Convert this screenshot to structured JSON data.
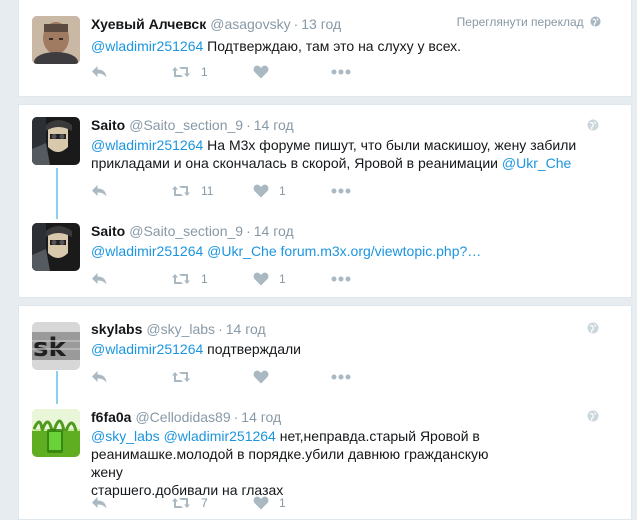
{
  "tweets": [
    {
      "name": "Хуевый Алчевск",
      "handle": "@asagovsky",
      "time": "13 год",
      "view_conversation": "Переглянути переклад",
      "text_parts": [
        "@wladimir251264",
        " Подтверждаю, там это на слуху у всех."
      ],
      "retweets": "1",
      "likes": ""
    },
    {
      "name": "Saito",
      "handle": "@Saito_section_9",
      "time": "14 год",
      "text_line1_parts": [
        "@wladimir251264",
        " На M3x форуме пишут, что были маскишоу, жену забили"
      ],
      "text_line2_parts": [
        "прикладами и она скончалась в скорой, Яровой в реанимации ",
        "@Ukr_Che"
      ],
      "retweets": "11",
      "likes": "1"
    },
    {
      "name": "Saito",
      "handle": "@Saito_section_9",
      "time": "14 год",
      "text_parts": [
        "@wladimir251264",
        " ",
        "@Ukr_Che",
        " ",
        "forum.m3x.org/viewtopic.php?…"
      ],
      "retweets": "1",
      "likes": "1"
    },
    {
      "name": "skylabs",
      "handle": "@sky_labs",
      "time": "14 год",
      "text_parts": [
        "@wladimir251264",
        " подтверждали"
      ],
      "retweets": "",
      "likes": ""
    },
    {
      "name": "f6fa0a",
      "handle": "@Cellodidas89",
      "time": "14 год",
      "text_line1_parts": [
        "@sky_labs",
        " ",
        "@wladimir251264",
        " нет,неправда.старый Яровой в"
      ],
      "text_line2": "реанимашке.молодой в порядке.убили давнюю гражданскую жену",
      "text_line3": "старшего.добивали на глазах",
      "retweets": "7",
      "likes": "1"
    }
  ],
  "icons": {
    "reply": "reply-icon",
    "retweet": "retweet-icon",
    "like": "heart-icon",
    "more": "more-icon",
    "globe": "globe-icon"
  },
  "colors": {
    "link": "#1b95e0",
    "muted": "#8899a6",
    "thread_line": "#8ccff1",
    "background": "#e6ecf0"
  }
}
